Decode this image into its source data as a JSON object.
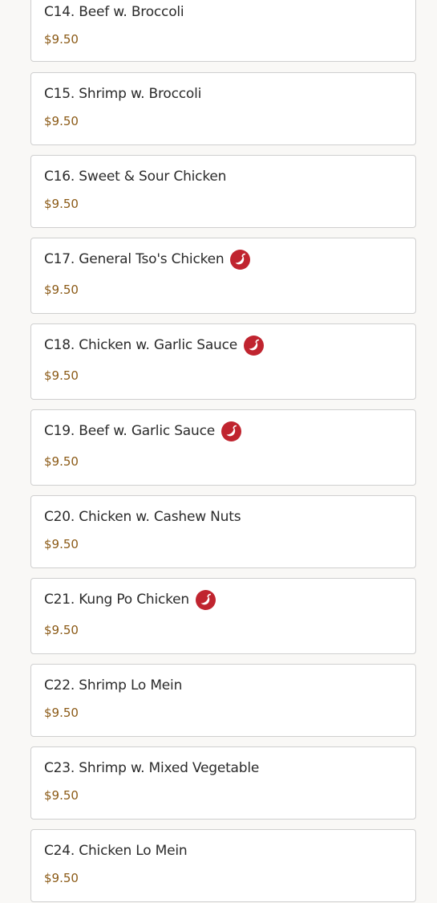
{
  "menu": {
    "items": [
      {
        "name": "C14. Beef w. Broccoli",
        "price": "$9.50",
        "spicy": false
      },
      {
        "name": "C15. Shrimp w. Broccoli",
        "price": "$9.50",
        "spicy": false
      },
      {
        "name": "C16. Sweet & Sour Chicken",
        "price": "$9.50",
        "spicy": false
      },
      {
        "name": "C17. General Tso's Chicken",
        "price": "$9.50",
        "spicy": true
      },
      {
        "name": "C18. Chicken w. Garlic Sauce",
        "price": "$9.50",
        "spicy": true
      },
      {
        "name": "C19. Beef w. Garlic Sauce",
        "price": "$9.50",
        "spicy": true
      },
      {
        "name": "C20. Chicken w. Cashew Nuts",
        "price": "$9.50",
        "spicy": false
      },
      {
        "name": "C21. Kung Po Chicken",
        "price": "$9.50",
        "spicy": true
      },
      {
        "name": "C22. Shrimp Lo Mein",
        "price": "$9.50",
        "spicy": false
      },
      {
        "name": "C23. Shrimp w. Mixed Vegetable",
        "price": "$9.50",
        "spicy": false
      },
      {
        "name": "C24. Chicken Lo Mein",
        "price": "$9.50",
        "spicy": false
      }
    ]
  },
  "colors": {
    "price": "#8b5a16",
    "spicy_badge": "#c0242f",
    "card_border": "#cfcfcf",
    "background": "#f9f8f6"
  },
  "icons": {
    "spicy": "chili-pepper-icon"
  }
}
